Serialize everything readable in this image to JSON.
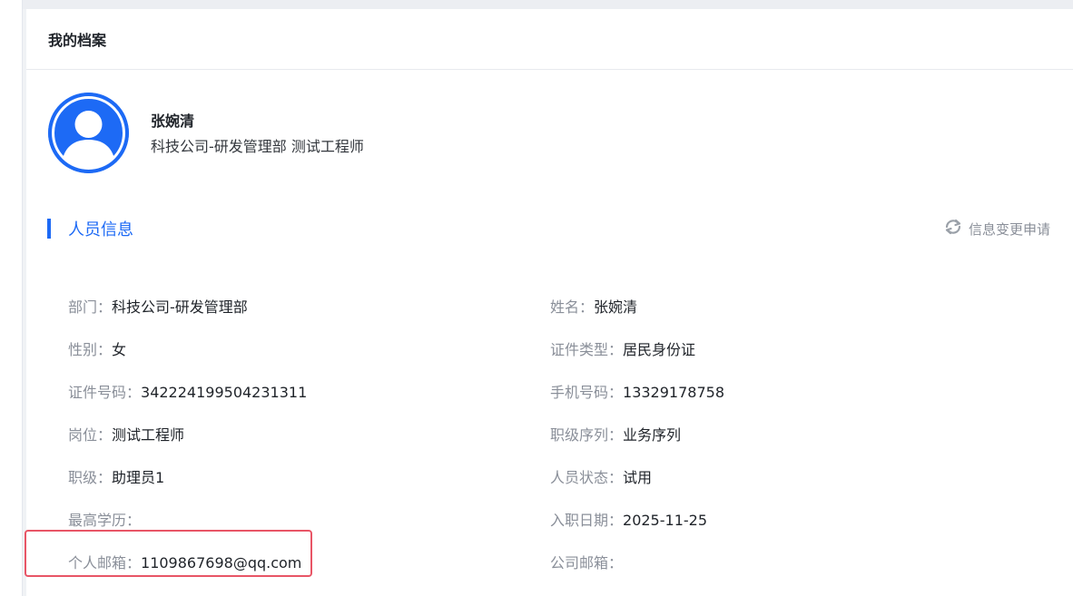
{
  "page": {
    "card_title": "我的档案"
  },
  "profile": {
    "name": "张婉清",
    "subtitle": "科技公司-研发管理部 测试工程师",
    "avatar_icon": "user-avatar-icon",
    "avatar_color": "#1d6af5"
  },
  "section": {
    "title": "人员信息",
    "change_request_label": "信息变更申请",
    "change_request_icon": "refresh-icon",
    "accent_color": "#1d6af5"
  },
  "fields": {
    "rows": [
      {
        "left": {
          "label": "部门：",
          "value": "科技公司-研发管理部"
        },
        "right": {
          "label": "姓名：",
          "value": "张婉清"
        }
      },
      {
        "left": {
          "label": "性别：",
          "value": "女"
        },
        "right": {
          "label": "证件类型：",
          "value": "居民身份证"
        }
      },
      {
        "left": {
          "label": "证件号码：",
          "value": "342224199504231311"
        },
        "right": {
          "label": "手机号码：",
          "value": "13329178758"
        }
      },
      {
        "left": {
          "label": "岗位：",
          "value": "测试工程师"
        },
        "right": {
          "label": "职级序列：",
          "value": "业务序列"
        }
      },
      {
        "left": {
          "label": "职级：",
          "value": "助理员1"
        },
        "right": {
          "label": "人员状态：",
          "value": "试用"
        }
      },
      {
        "left": {
          "label": "最高学历：",
          "value": ""
        },
        "right": {
          "label": "入职日期：",
          "value": "2025-11-25"
        }
      },
      {
        "left": {
          "label": "个人邮箱：",
          "value": "1109867698@qq.com"
        },
        "right": {
          "label": "公司邮箱：",
          "value": ""
        }
      }
    ]
  },
  "highlight_color": "#e85566"
}
